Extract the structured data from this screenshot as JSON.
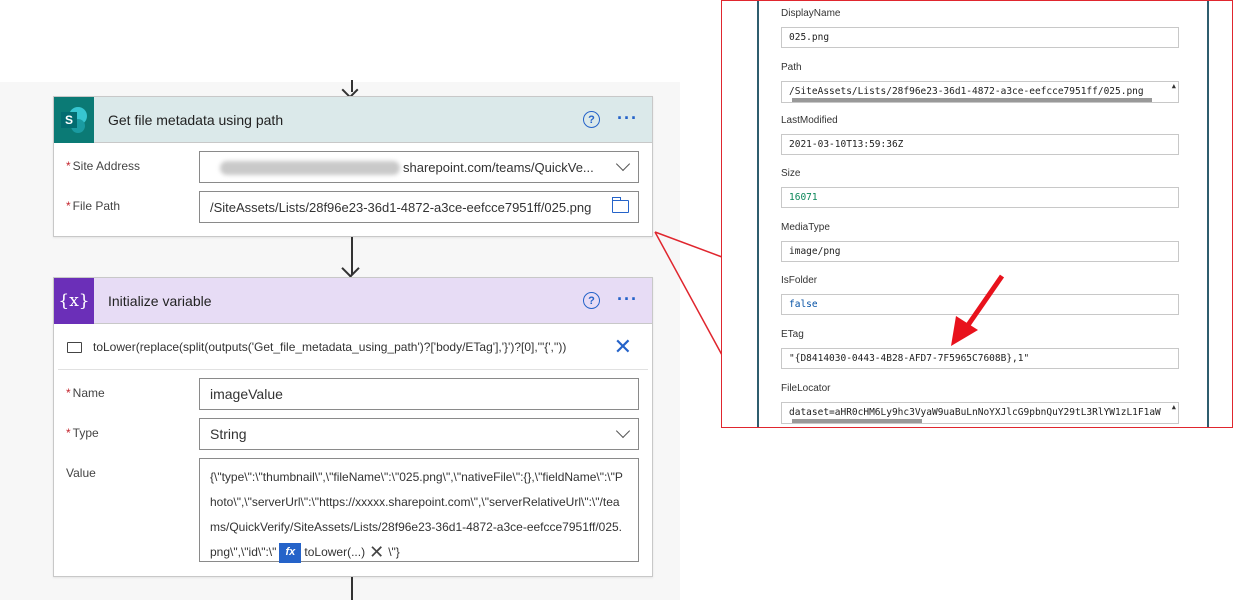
{
  "colors": {
    "sharepoint_teal": "#0b7a75",
    "variable_purple": "#6b2fb8",
    "sp_header_bg": "#dbe9ea",
    "var_header_bg": "#e7dcf5",
    "accent_blue": "#2563c9",
    "callout_red": "#e0262e"
  },
  "metadata_card": {
    "title": "Get file metadata using path",
    "icon": "sharepoint-icon",
    "icon_letter": "S",
    "fields": {
      "site_address_label": "Site Address",
      "site_address_value": "sharepoint.com/teams/QuickVe...",
      "file_path_label": "File Path",
      "file_path_value": "/SiteAssets/Lists/28f96e23-36d1-4872-a3ce-eefcce7951ff/025.png"
    }
  },
  "variable_card": {
    "title": "Initialize variable",
    "icon_glyph": "{x}",
    "expression": "toLower(replace(split(outputs('Get_file_metadata_using_path')?['body/ETag'],'}')?[0],'\"{',''))",
    "name_label": "Name",
    "name_value": "imageValue",
    "type_label": "Type",
    "type_value": "String",
    "value_label": "Value",
    "value_text": "{\\\"type\\\":\\\"thumbnail\\\",\\\"fileName\\\":\\\"025.png\\\",\\\"nativeFile\\\":{},\\\"fieldName\\\":\\\"Photo\\\",\\\"serverUrl\\\":\\\"https://xxxxx.sharepoint.com\\\",\\\"serverRelativeUrl\\\":\\\"/teams/QuickVerify/SiteAssets/Lists/28f96e23-36d1-4872-a3ce-eefcce7951ff/025.png\\\",\\\"id\\\":\\\"",
    "fx_label": "fx",
    "fx_token": "toLower(...)",
    "value_tail": "\\\"}"
  },
  "properties": [
    {
      "name": "DisplayName",
      "value": "025.png",
      "style": "str"
    },
    {
      "name": "Path",
      "value": "/SiteAssets/Lists/28f96e23-36d1-4872-a3ce-eefcce7951ff/025.png",
      "style": "str"
    },
    {
      "name": "LastModified",
      "value": "2021-03-10T13:59:36Z",
      "style": "str"
    },
    {
      "name": "Size",
      "value": "16071",
      "style": "num"
    },
    {
      "name": "MediaType",
      "value": "image/png",
      "style": "str"
    },
    {
      "name": "IsFolder",
      "value": "false",
      "style": "kw"
    },
    {
      "name": "ETag",
      "value": "\"{D8414030-0443-4B28-AFD7-7F5965C7608B},1\"",
      "style": "str"
    },
    {
      "name": "FileLocator",
      "value": "dataset=aHR0cHM6Ly9hc3VyaW9uaBuLnNoYXJlcG9pbnQuY29tL3RlYW1zL1F1aW",
      "style": "str"
    }
  ]
}
